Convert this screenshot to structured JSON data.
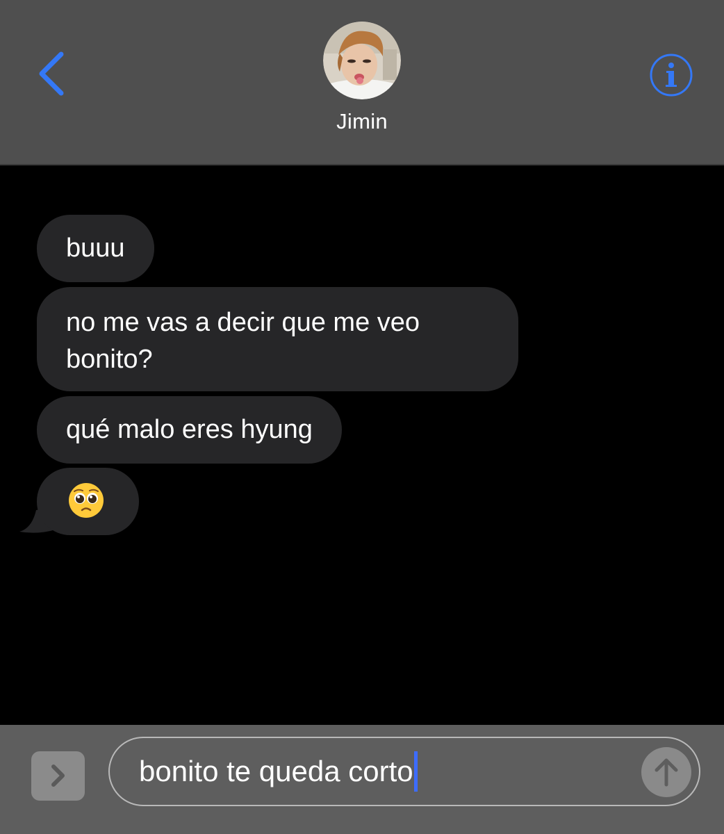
{
  "header": {
    "contact_name": "Jimin",
    "accent_color": "#3478f6"
  },
  "messages": [
    {
      "direction": "incoming",
      "text": "buuu"
    },
    {
      "direction": "incoming",
      "text": "no me vas a decir que me veo bonito?"
    },
    {
      "direction": "incoming",
      "text": "qué malo eres hyung"
    },
    {
      "direction": "incoming",
      "text": "🥺"
    }
  ],
  "composer": {
    "value": "bonito te queda corto"
  },
  "icons": {
    "back": "chevron-left-icon",
    "info": "info-icon",
    "apps": "chevron-right-icon",
    "send": "arrow-up-icon"
  }
}
